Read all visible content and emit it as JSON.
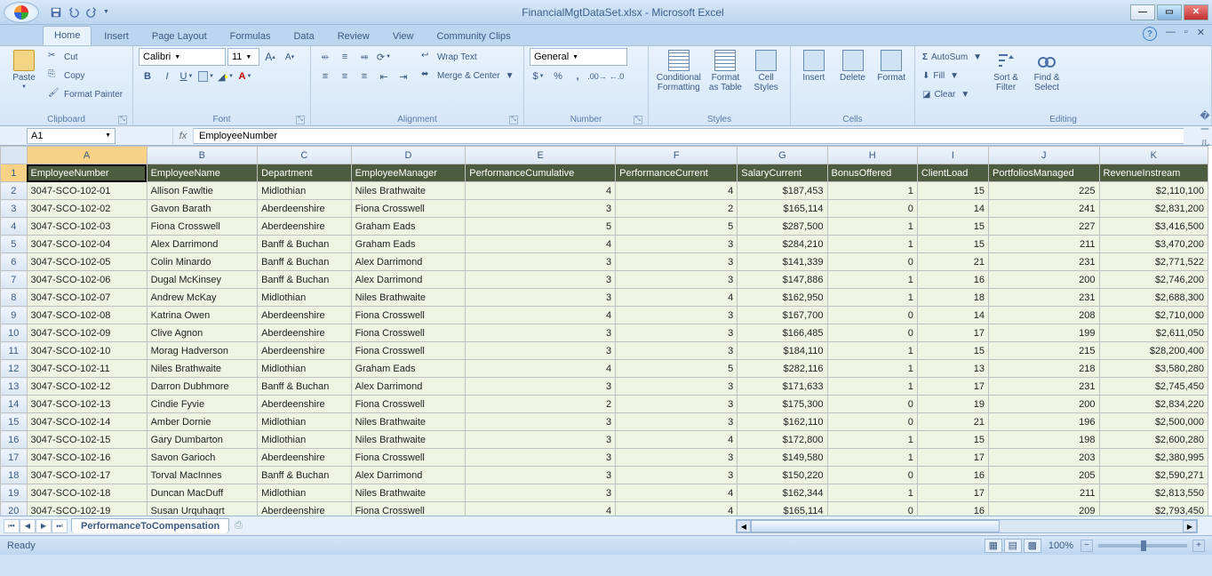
{
  "title": "FinancialMgtDataSet.xlsx - Microsoft Excel",
  "tabs": {
    "home": "Home",
    "insert": "Insert",
    "page": "Page Layout",
    "formulas": "Formulas",
    "data": "Data",
    "review": "Review",
    "view": "View",
    "community": "Community Clips"
  },
  "ribbon": {
    "clipboard": {
      "label": "Clipboard",
      "paste": "Paste",
      "cut": "Cut",
      "copy": "Copy",
      "painter": "Format Painter"
    },
    "font": {
      "label": "Font",
      "name": "Calibri",
      "size": "11"
    },
    "alignment": {
      "label": "Alignment",
      "wrap": "Wrap Text",
      "merge": "Merge & Center"
    },
    "number": {
      "label": "Number",
      "format": "General"
    },
    "styles": {
      "label": "Styles",
      "cond": "Conditional\nFormatting",
      "asTable": "Format\nas Table",
      "cellStyles": "Cell\nStyles"
    },
    "cells": {
      "label": "Cells",
      "insert": "Insert",
      "delete": "Delete",
      "format": "Format"
    },
    "editing": {
      "label": "Editing",
      "autosum": "AutoSum",
      "fill": "Fill",
      "clear": "Clear",
      "sort": "Sort &\nFilter",
      "find": "Find &\nSelect"
    }
  },
  "namebox": "A1",
  "formula": "EmployeeNumber",
  "columns": [
    "A",
    "B",
    "C",
    "D",
    "E",
    "F",
    "G",
    "H",
    "I",
    "J",
    "K"
  ],
  "headers": [
    "EmployeeNumber",
    "EmployeeName",
    "Department",
    "EmployeeManager",
    "PerformanceCumulative",
    "PerformanceCurrent",
    "SalaryCurrent",
    "BonusOffered",
    "ClientLoad",
    "PortfoliosManaged",
    "RevenueInstream"
  ],
  "rows": [
    [
      "3047-SCO-102-01",
      "Allison Fawltie",
      "Midlothian",
      "Niles Brathwaite",
      "4",
      "4",
      "$187,453",
      "1",
      "15",
      "225",
      "$2,110,100"
    ],
    [
      "3047-SCO-102-02",
      "Gavon Barath",
      "Aberdeenshire",
      "Fiona Crosswell",
      "3",
      "2",
      "$165,114",
      "0",
      "14",
      "241",
      "$2,831,200"
    ],
    [
      "3047-SCO-102-03",
      "Fiona Crosswell",
      "Aberdeenshire",
      "Graham Eads",
      "5",
      "5",
      "$287,500",
      "1",
      "15",
      "227",
      "$3,416,500"
    ],
    [
      "3047-SCO-102-04",
      "Alex Darrimond",
      "Banff & Buchan",
      "Graham Eads",
      "4",
      "3",
      "$284,210",
      "1",
      "15",
      "211",
      "$3,470,200"
    ],
    [
      "3047-SCO-102-05",
      "Colin Minardo",
      "Banff & Buchan",
      "Alex Darrimond",
      "3",
      "3",
      "$141,339",
      "0",
      "21",
      "231",
      "$2,771,522"
    ],
    [
      "3047-SCO-102-06",
      "Dugal McKinsey",
      "Banff & Buchan",
      "Alex Darrimond",
      "3",
      "3",
      "$147,886",
      "1",
      "16",
      "200",
      "$2,746,200"
    ],
    [
      "3047-SCO-102-07",
      "Andrew McKay",
      "Midlothian",
      "Niles Brathwaite",
      "3",
      "4",
      "$162,950",
      "1",
      "18",
      "231",
      "$2,688,300"
    ],
    [
      "3047-SCO-102-08",
      "Katrina Owen",
      "Aberdeenshire",
      "Fiona Crosswell",
      "4",
      "3",
      "$167,700",
      "0",
      "14",
      "208",
      "$2,710,000"
    ],
    [
      "3047-SCO-102-09",
      "Clive Agnon",
      "Aberdeenshire",
      "Fiona Crosswell",
      "3",
      "3",
      "$166,485",
      "0",
      "17",
      "199",
      "$2,611,050"
    ],
    [
      "3047-SCO-102-10",
      "Morag Hadverson",
      "Aberdeenshire",
      "Fiona Crosswell",
      "3",
      "3",
      "$184,110",
      "1",
      "15",
      "215",
      "$28,200,400"
    ],
    [
      "3047-SCO-102-11",
      "Niles Brathwaite",
      "Midlothian",
      "Graham Eads",
      "4",
      "5",
      "$282,116",
      "1",
      "13",
      "218",
      "$3,580,280"
    ],
    [
      "3047-SCO-102-12",
      "Darron Dubhmore",
      "Banff & Buchan",
      "Alex Darrimond",
      "3",
      "3",
      "$171,633",
      "1",
      "17",
      "231",
      "$2,745,450"
    ],
    [
      "3047-SCO-102-13",
      "Cindie Fyvie",
      "Aberdeenshire",
      "Fiona Crosswell",
      "2",
      "3",
      "$175,300",
      "0",
      "19",
      "200",
      "$2,834,220"
    ],
    [
      "3047-SCO-102-14",
      "Amber Dornie",
      "Midlothian",
      "Niles Brathwaite",
      "3",
      "3",
      "$162,110",
      "0",
      "21",
      "196",
      "$2,500,000"
    ],
    [
      "3047-SCO-102-15",
      "Gary Dumbarton",
      "Midlothian",
      "Niles Brathwaite",
      "3",
      "4",
      "$172,800",
      "1",
      "15",
      "198",
      "$2,600,280"
    ],
    [
      "3047-SCO-102-16",
      "Savon Garioch",
      "Aberdeenshire",
      "Fiona Crosswell",
      "3",
      "3",
      "$149,580",
      "1",
      "17",
      "203",
      "$2,380,995"
    ],
    [
      "3047-SCO-102-17",
      "Torval MacInnes",
      "Banff & Buchan",
      "Alex Darrimond",
      "3",
      "3",
      "$150,220",
      "0",
      "16",
      "205",
      "$2,590,271"
    ],
    [
      "3047-SCO-102-18",
      "Duncan MacDuff",
      "Midlothian",
      "Niles Brathwaite",
      "3",
      "4",
      "$162,344",
      "1",
      "17",
      "211",
      "$2,813,550"
    ],
    [
      "3047-SCO-102-19",
      "Susan Urquhaqrt",
      "Aberdeenshire",
      "Fiona Crosswell",
      "4",
      "4",
      "$165,114",
      "0",
      "16",
      "209",
      "$2,793,450"
    ]
  ],
  "sheet_tab": "PerformanceToCompensation",
  "status": {
    "ready": "Ready",
    "zoom": "100%"
  }
}
